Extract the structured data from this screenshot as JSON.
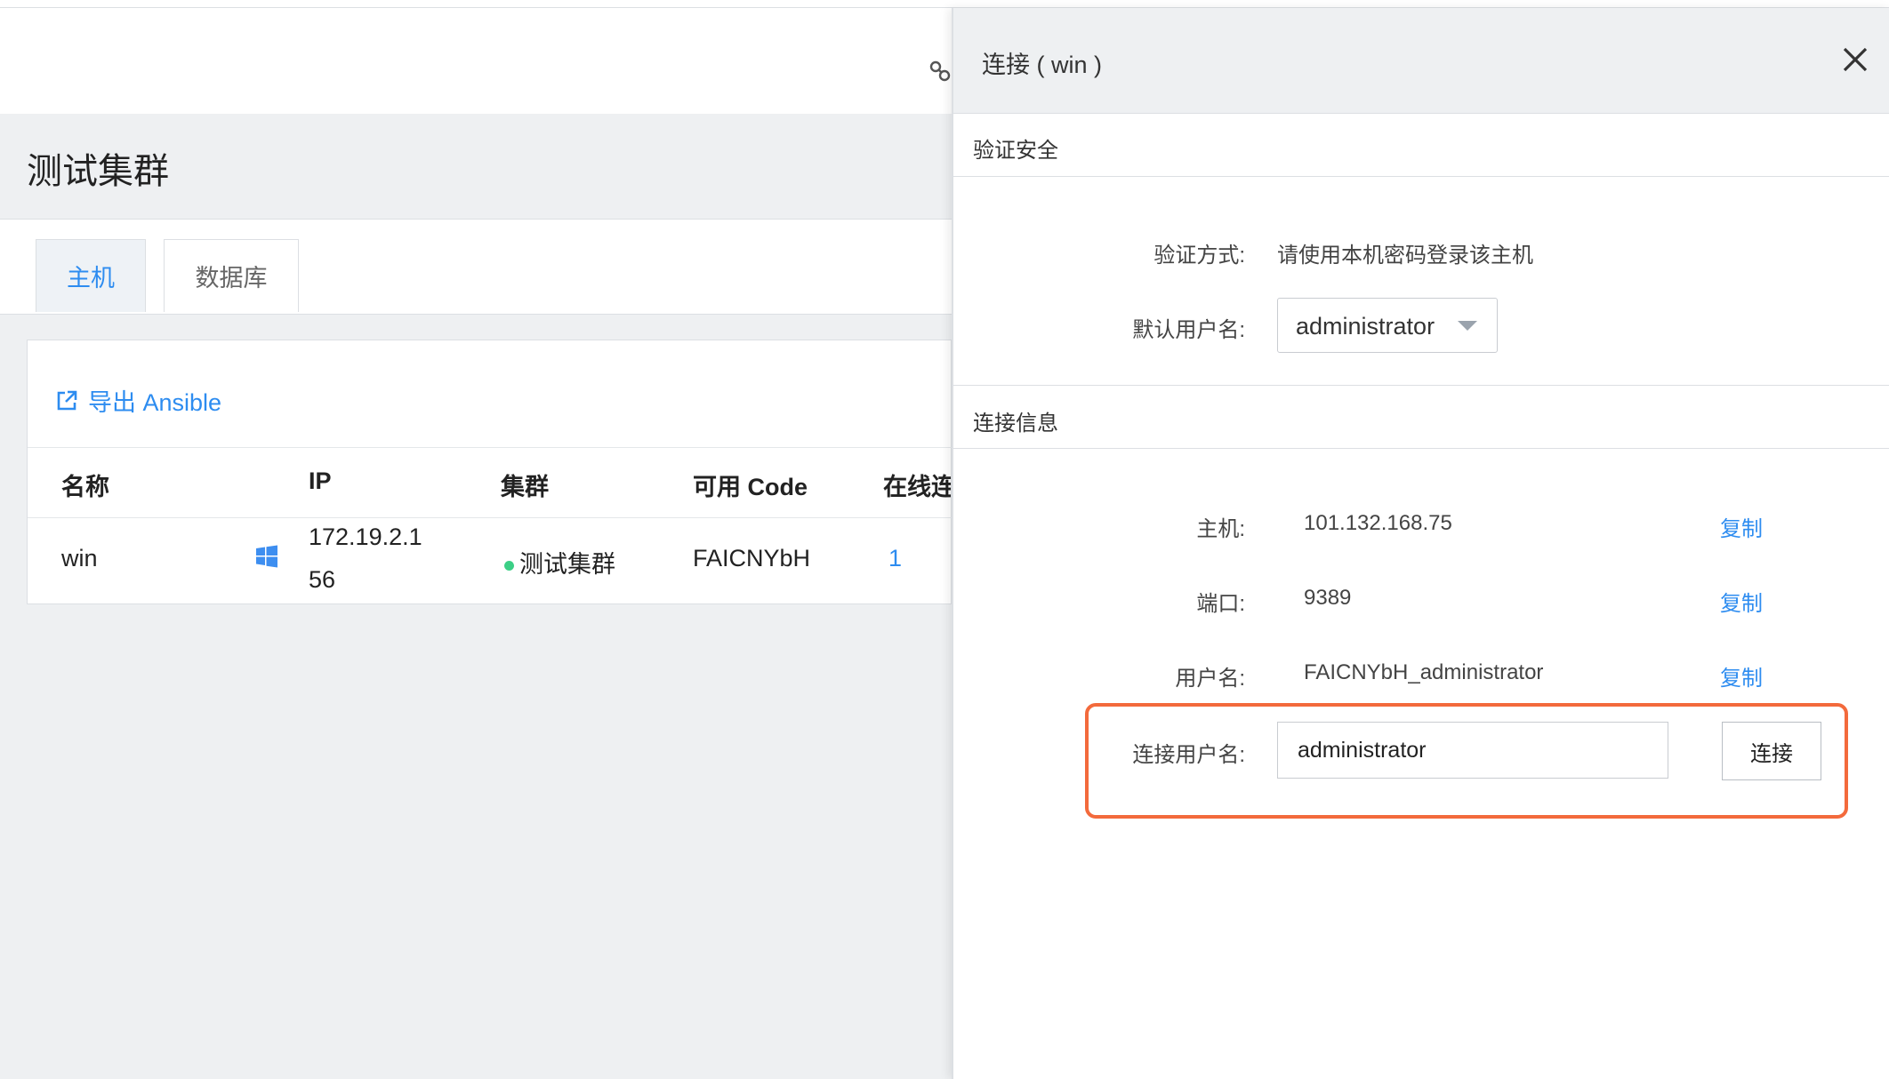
{
  "page": {
    "title": "测试集群",
    "tabs": [
      {
        "label": "主机",
        "active": true
      },
      {
        "label": "数据库",
        "active": false
      }
    ],
    "export_label": "导出 Ansible",
    "table": {
      "headers": [
        "名称",
        "IP",
        "集群",
        "可用 Code",
        "在线连"
      ],
      "rows": [
        {
          "name": "win",
          "os_icon": "windows-icon",
          "ip_line1": "172.19.2.1",
          "ip_line2": "56",
          "cluster": "测试集群",
          "cluster_status_color": "#3ccf86",
          "code": "FAICNYbH",
          "online": "1"
        }
      ]
    }
  },
  "drawer": {
    "title": "连接 ( win )",
    "security_section": "验证安全",
    "auth_label": "验证方式:",
    "auth_value": "请使用本机密码登录该主机",
    "default_user_label": "默认用户名:",
    "default_user_value": "administrator",
    "info_section": "连接信息",
    "host_label": "主机:",
    "host_value": "101.132.168.75",
    "port_label": "端口:",
    "port_value": "9389",
    "username_label": "用户名:",
    "username_value": "FAICNYbH_administrator",
    "copy_label": "复制",
    "connect_user_label": "连接用户名:",
    "connect_user_value": "administrator",
    "connect_button": "连接"
  },
  "colors": {
    "accent": "#2d8cf0",
    "highlight": "#f36a3c",
    "status_green": "#3ccf86"
  }
}
